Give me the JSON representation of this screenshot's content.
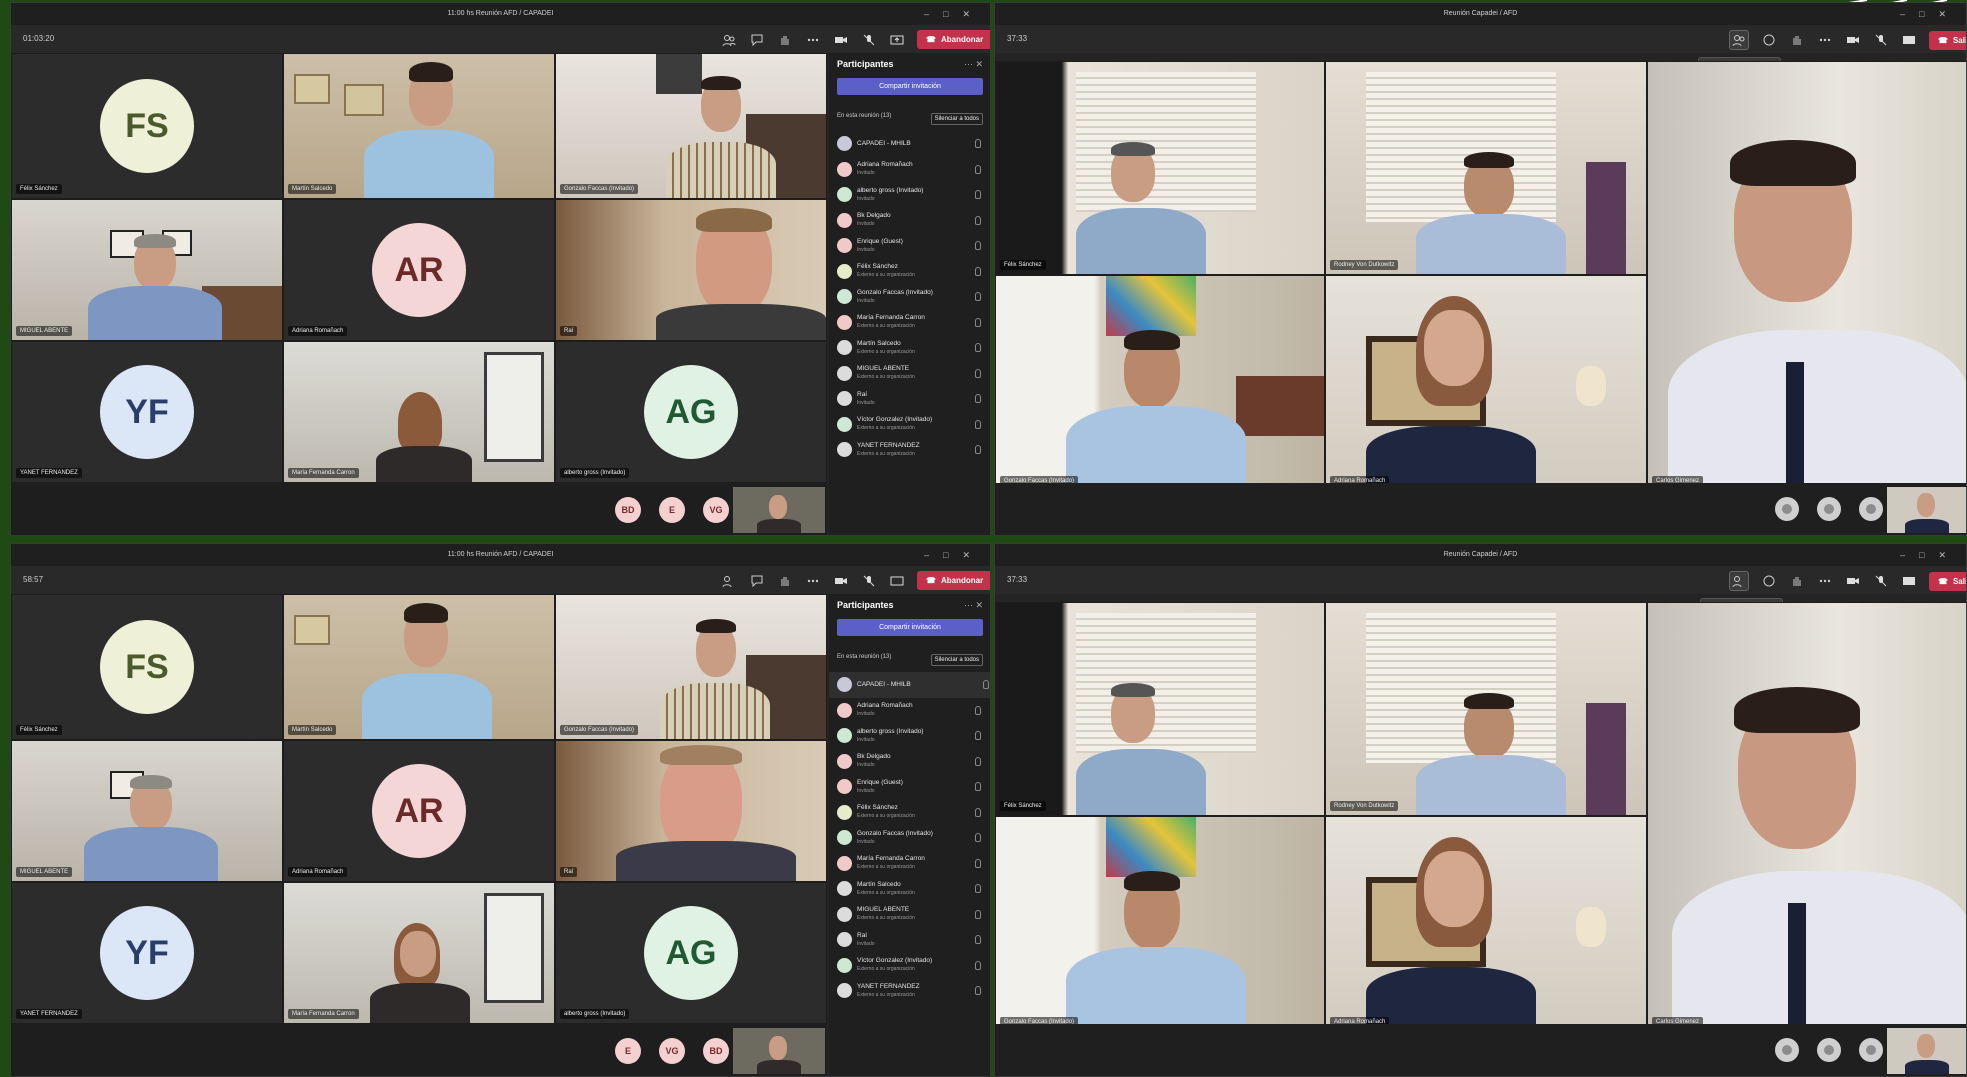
{
  "win1": {
    "title": "11:00 hs Reunión AFD / CAPADEI",
    "timer": "01:03:20",
    "leave_label": "Abandonar",
    "tiles": [
      "Félix Sánchez",
      "Martín Salcedo",
      "Gonzalo Faccas (Invitado)",
      "MIGUEL ABENTE",
      "Adriana Romañach",
      "Raí",
      "YANET FERNANDEZ",
      "María Fernanda Carron",
      "alberto gross (Invitado)"
    ],
    "avatars": {
      "fs": "FS",
      "ar": "AR",
      "yf": "YF",
      "ag": "AG"
    },
    "minis": [
      "BD",
      "E",
      "VG"
    ],
    "panel": {
      "title": "Participantes",
      "share": "Compartir invitación",
      "in_meeting": "En esta reunión (13)",
      "mute_all": "Silenciar a todos",
      "people": [
        {
          "name": "CAPADEI - MHILB",
          "sub": ""
        },
        {
          "name": "Adriana Romañach",
          "sub": "Invitado"
        },
        {
          "name": "alberto gross (Invitado)",
          "sub": "Invitado"
        },
        {
          "name": "Bk Delgado",
          "sub": "Invitado"
        },
        {
          "name": "Enrique (Guest)",
          "sub": "Invitado"
        },
        {
          "name": "Félix Sánchez",
          "sub": "Externo a su organización"
        },
        {
          "name": "Gonzalo Faccas (Invitado)",
          "sub": "Invitado"
        },
        {
          "name": "María Fernanda Carron",
          "sub": "Externo a su organización"
        },
        {
          "name": "Martín Salcedo",
          "sub": "Externo a su organización"
        },
        {
          "name": "MIGUEL ABENTE",
          "sub": "Externo a su organización"
        },
        {
          "name": "Raí",
          "sub": "Invitado"
        },
        {
          "name": "Víctor Gonzalez (Invitado)",
          "sub": "Externo a su organización"
        },
        {
          "name": "YANET FERNANDEZ",
          "sub": "Externo a su organización"
        }
      ]
    }
  },
  "win2": {
    "title": "Reunión Capadei / AFD",
    "timer": "37:33",
    "leave_label": "Salir",
    "tooltip": "Mostrar participantes",
    "tiles": [
      "Félix Sánchez",
      "Rodney Von Dutkowitz",
      "Gonzalo Faccas (Invitado)",
      "Adriana Romañach",
      "Carlos Gimenez"
    ]
  },
  "win3": {
    "title": "11:00 hs Reunión AFD / CAPADEI",
    "timer": "58:57",
    "leave_label": "Abandonar",
    "minis": [
      "E",
      "VG",
      "BD"
    ]
  },
  "win4": {
    "title": "Reunión Capadei / AFD",
    "timer": "37:33",
    "leave_label": "Salir",
    "tooltip": "Mostrar participantes"
  },
  "colors": {
    "leave": "#c4314b",
    "share": "#5b5fc7",
    "desktop": "#1f4a14"
  }
}
